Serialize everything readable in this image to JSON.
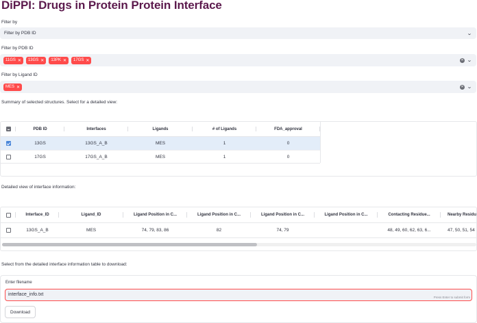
{
  "title": "DiPPI: Drugs in Protein Protein Interface",
  "filter_by": {
    "label": "Filter by",
    "value": "Filter by PDB ID"
  },
  "pdb_filter": {
    "label": "Filter by PDB ID",
    "tags": [
      "11GS",
      "13GS",
      "13PK",
      "17GS"
    ]
  },
  "ligand_filter": {
    "label": "Filter by Ligand ID",
    "tags": [
      "MES"
    ]
  },
  "summary": {
    "caption": "Summary of selected structures. Select for a detailed view:",
    "columns": [
      "PDB ID",
      "Interfaces",
      "Ligands",
      "# of Ligands",
      "FDA_approval"
    ],
    "rows": [
      {
        "selected": true,
        "cells": [
          "13GS",
          "13GS_A_B",
          "MES",
          "1",
          "0"
        ]
      },
      {
        "selected": false,
        "cells": [
          "17GS",
          "17GS_A_B",
          "MES",
          "1",
          "0"
        ]
      }
    ]
  },
  "detail": {
    "caption": "Detailed view of interface information:",
    "columns": [
      "Interface_ID",
      "Ligand_ID",
      "Ligand Position in C...",
      "Ligand Position in C...",
      "Ligand Position in C...",
      "Ligand Position in C...",
      "Contacting Residue...",
      "Nearby Residu"
    ],
    "rows": [
      {
        "selected": false,
        "cells": [
          "13GS_A_B",
          "MES",
          "74, 79, 83, 86",
          "82",
          "74, 79",
          "",
          "48, 49, 60, 62, 63, 6...",
          "47, 50, 51, 54"
        ]
      }
    ]
  },
  "download": {
    "caption": "Select from the detailed interface information table to download:",
    "filename_label": "Enter filename",
    "filename_value": "interface_info.txt",
    "hint": "Press Enter to submit form",
    "button_label": "Download"
  },
  "colors": {
    "title": "#5c1a4d",
    "tag": "#ff4b4b",
    "selected_row": "#e3edf9",
    "checkbox": "#4a86d9"
  }
}
